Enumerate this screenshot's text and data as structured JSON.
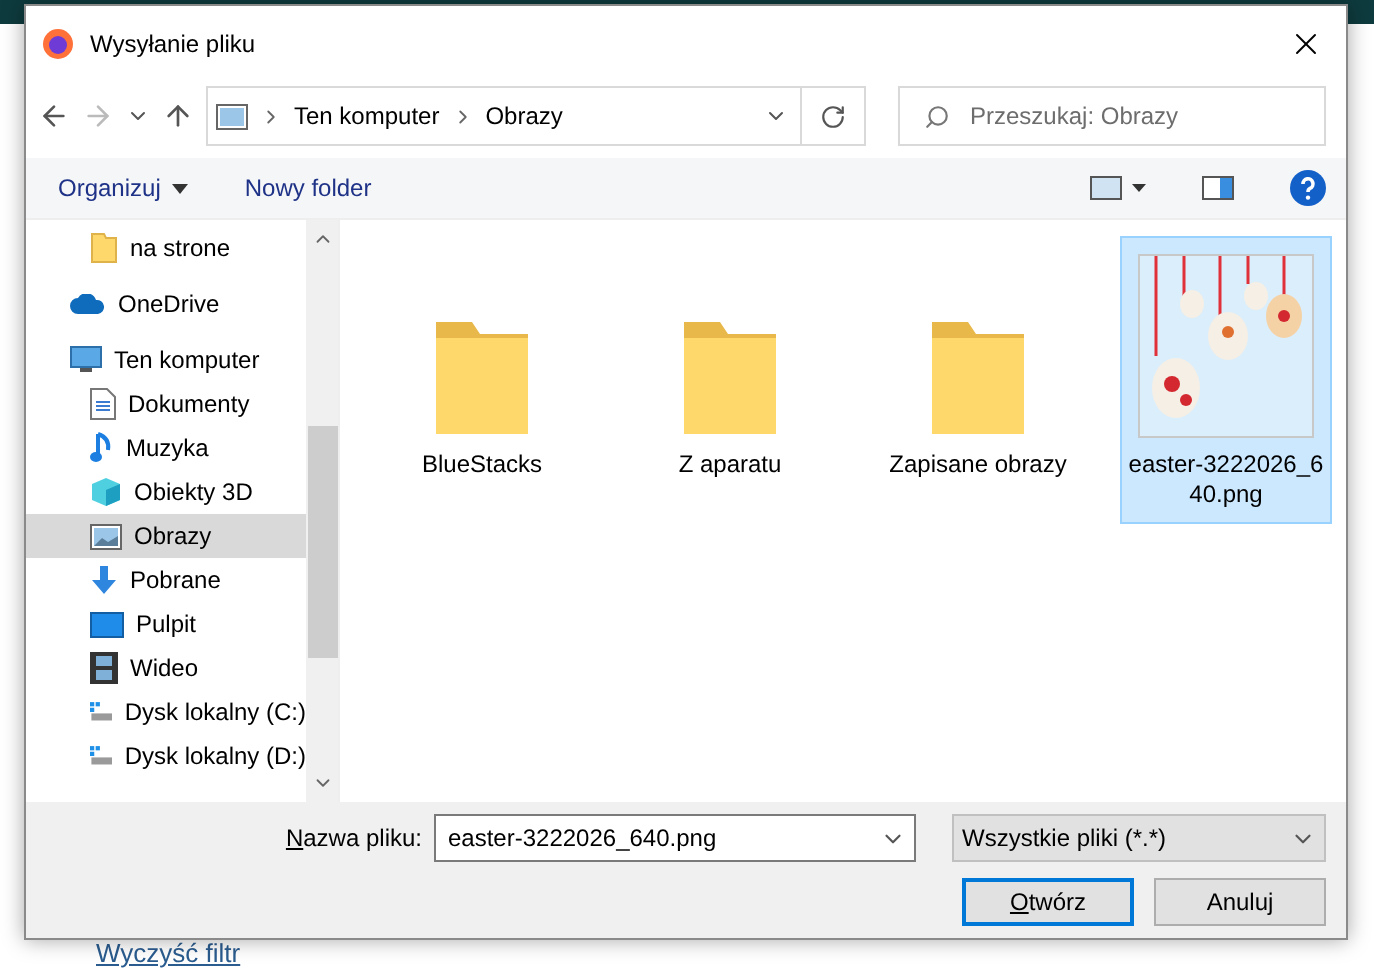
{
  "window": {
    "title": "Wysyłanie pliku"
  },
  "address": {
    "path": [
      "Ten komputer",
      "Obrazy"
    ]
  },
  "search": {
    "placeholder": "Przeszukaj: Obrazy"
  },
  "toolbar": {
    "organize": "Organizuj",
    "new_folder": "Nowy folder"
  },
  "nav": {
    "items": [
      {
        "children": [
          {
            "label": "na strone",
            "kind": "folder",
            "selected": false
          }
        ]
      },
      {
        "label": "OneDrive",
        "kind": "cloud",
        "selected": false
      },
      {
        "label": "Ten komputer",
        "kind": "computer",
        "selected": false,
        "children": [
          {
            "label": "Dokumenty",
            "kind": "documents",
            "selected": false
          },
          {
            "label": "Muzyka",
            "kind": "music",
            "selected": false
          },
          {
            "label": "Obiekty 3D",
            "kind": "cube",
            "selected": false
          },
          {
            "label": "Obrazy",
            "kind": "pictures",
            "selected": true
          },
          {
            "label": "Pobrane",
            "kind": "download",
            "selected": false
          },
          {
            "label": "Pulpit",
            "kind": "desktop",
            "selected": false
          },
          {
            "label": "Wideo",
            "kind": "video",
            "selected": false
          },
          {
            "label": "Dysk lokalny (C:)",
            "kind": "drive",
            "selected": false
          },
          {
            "label": "Dysk lokalny (D:)",
            "kind": "drive",
            "selected": false
          }
        ]
      }
    ]
  },
  "files": [
    {
      "label": "BlueStacks",
      "kind": "folder",
      "selected": false
    },
    {
      "label": "Z aparatu",
      "kind": "folder",
      "selected": false
    },
    {
      "label": "Zapisane obrazy",
      "kind": "folder",
      "selected": false
    },
    {
      "label": "easter-3222026_640.png",
      "kind": "image",
      "selected": true
    }
  ],
  "filename": {
    "label": "Nazwa pliku:",
    "value": "easter-3222026_640.png"
  },
  "filter": {
    "value": "Wszystkie pliki (*.*)"
  },
  "buttons": [
    {
      "label": "Otwórz",
      "default": true
    },
    {
      "label": "Anuluj",
      "default": false
    }
  ],
  "background": {
    "link": "Wyczyść filtr"
  }
}
